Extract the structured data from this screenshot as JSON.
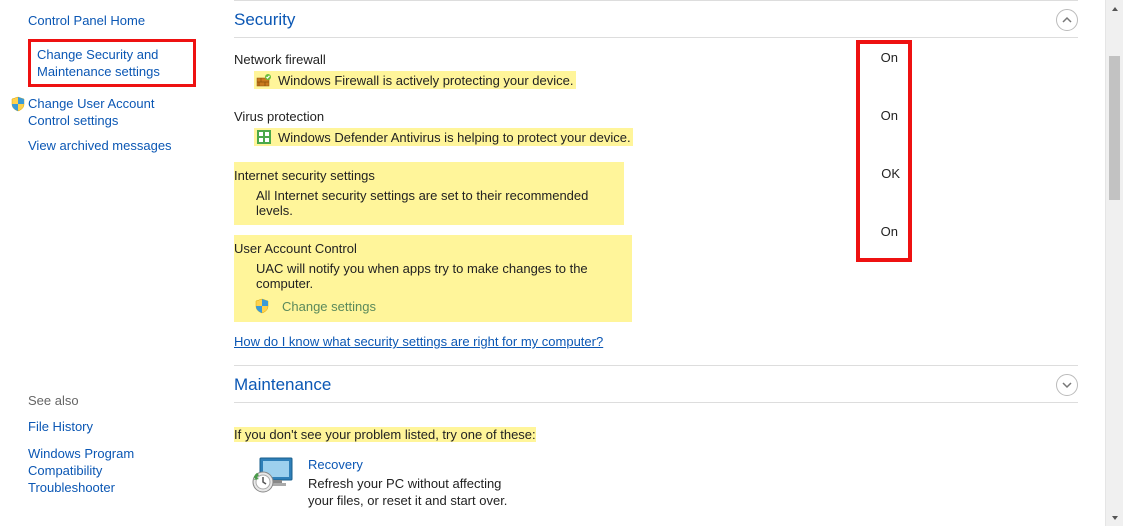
{
  "sidebar": {
    "home": "Control Panel Home",
    "change_sec": "Change Security and Maintenance settings",
    "change_uac": "Change User Account Control settings",
    "view_archived": "View archived messages",
    "see_also_title": "See also",
    "file_history": "File History",
    "wpct": "Windows Program Compatibility Troubleshooter"
  },
  "security": {
    "title": "Security",
    "network_firewall": {
      "title": "Network firewall",
      "desc": "Windows Firewall is actively protecting your device.",
      "status": "On"
    },
    "virus": {
      "title": "Virus protection",
      "desc": "Windows Defender Antivirus is helping to protect your device.",
      "status": "On"
    },
    "internet": {
      "title": "Internet security settings",
      "desc": "All Internet security settings are set to their recommended levels.",
      "status": "OK"
    },
    "uac": {
      "title": "User Account Control",
      "desc": "UAC will notify you when apps try to make changes to the computer.",
      "change": "Change settings",
      "status": "On"
    },
    "help_link": "How do I know what security settings are right for my computer?"
  },
  "maintenance": {
    "title": "Maintenance"
  },
  "try_text": "If you don't see your problem listed, try one of these:",
  "recovery": {
    "title": "Recovery",
    "desc1": "Refresh your PC without affecting",
    "desc2": "your files, or reset it and start over."
  }
}
